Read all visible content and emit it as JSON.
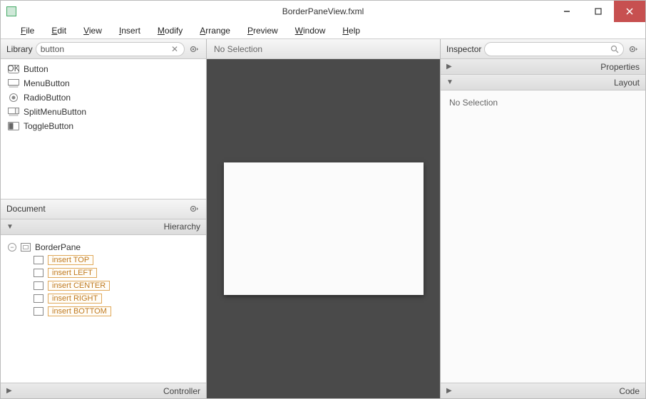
{
  "window": {
    "title": "BorderPaneView.fxml"
  },
  "menu": {
    "items": [
      "File",
      "Edit",
      "View",
      "Insert",
      "Modify",
      "Arrange",
      "Preview",
      "Window",
      "Help"
    ]
  },
  "library": {
    "label": "Library",
    "search_value": "button",
    "items": [
      {
        "icon": "ok-button-icon",
        "name": "Button"
      },
      {
        "icon": "menu-button-icon",
        "name": "MenuButton"
      },
      {
        "icon": "radio-button-icon",
        "name": "RadioButton"
      },
      {
        "icon": "split-menu-button-icon",
        "name": "SplitMenuButton"
      },
      {
        "icon": "toggle-button-icon",
        "name": "ToggleButton"
      }
    ]
  },
  "document": {
    "label": "Document",
    "hierarchy_label": "Hierarchy",
    "root": "BorderPane",
    "slots": [
      "insert TOP",
      "insert LEFT",
      "insert CENTER",
      "insert RIGHT",
      "insert BOTTOM"
    ]
  },
  "controller": {
    "label": "Controller"
  },
  "canvas": {
    "selection_label": "No Selection"
  },
  "inspector": {
    "label": "Inspector",
    "sections": {
      "properties": "Properties",
      "layout": "Layout",
      "code": "Code"
    },
    "body_text": "No Selection"
  }
}
